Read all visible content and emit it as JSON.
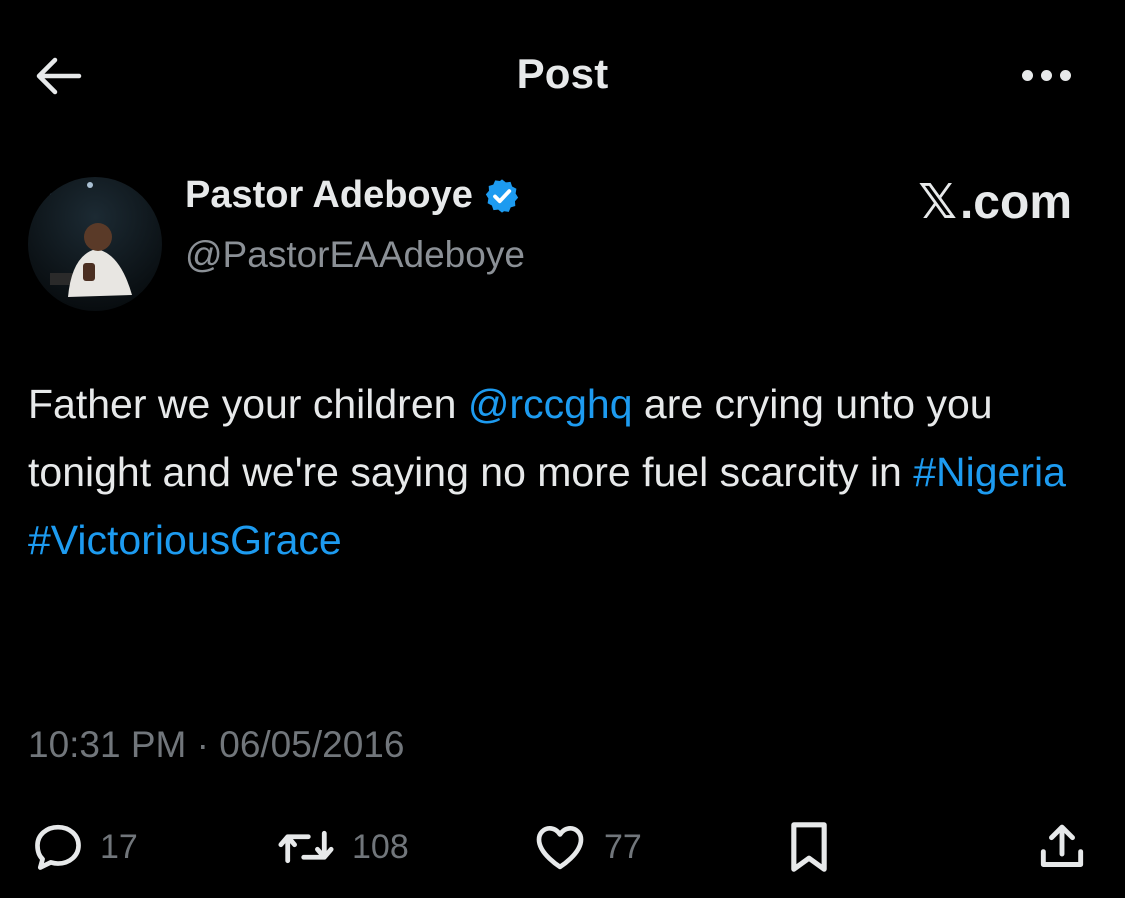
{
  "header": {
    "title": "Post",
    "back_icon": "arrow-left-icon",
    "more_icon": "more-horizontal-icon"
  },
  "author": {
    "display_name": "Pastor Adeboye",
    "handle": "@PastorEAAdeboye",
    "verified_icon": "verified-badge-icon",
    "verified_color": "#1d9bf0"
  },
  "brand": {
    "x_glyph": "𝕏",
    "suffix": ".com"
  },
  "tweet": {
    "segments": {
      "s1": "Father we your children ",
      "mention": "@rccghq",
      "s2": " are crying unto you tonight and we're saying no more fuel scarcity in ",
      "hashtag1": "#Nigeria",
      "hashtag2": "#VictoriousGrace"
    },
    "link_color": "#1d9bf0",
    "timestamp": "10:31 PM · 06/05/2016"
  },
  "actions": {
    "reply": {
      "icon": "reply-icon",
      "count": "17"
    },
    "repost": {
      "icon": "repost-icon",
      "count": "108"
    },
    "like": {
      "icon": "heart-icon",
      "count": "77"
    },
    "bookmark": {
      "icon": "bookmark-icon"
    },
    "share": {
      "icon": "share-icon"
    }
  },
  "colors": {
    "background": "#000000",
    "text_primary": "#e7e9ea",
    "text_secondary": "#71767b"
  }
}
